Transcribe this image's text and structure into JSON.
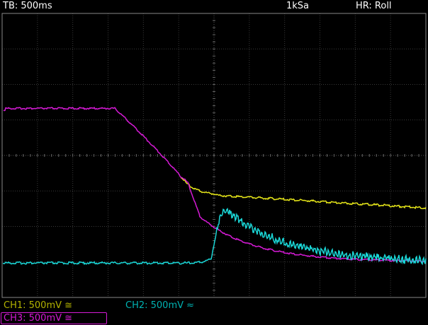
{
  "header": {
    "timebase": "TB: 500ms",
    "sample_rate": "1kSa",
    "mode": "HR: Roll"
  },
  "channels": [
    {
      "label": "CH1: 500mV ≅",
      "color": "#b3b300"
    },
    {
      "label": "CH2: 500mV ≈",
      "color": "#00b3b3"
    },
    {
      "label": "CH3: 500mV ≅",
      "color": "#d61ad6"
    }
  ],
  "traces": {
    "ch1_color": "#e6e619",
    "ch2_color": "#1ad6d6",
    "ch3_color": "#d61ad6"
  }
}
